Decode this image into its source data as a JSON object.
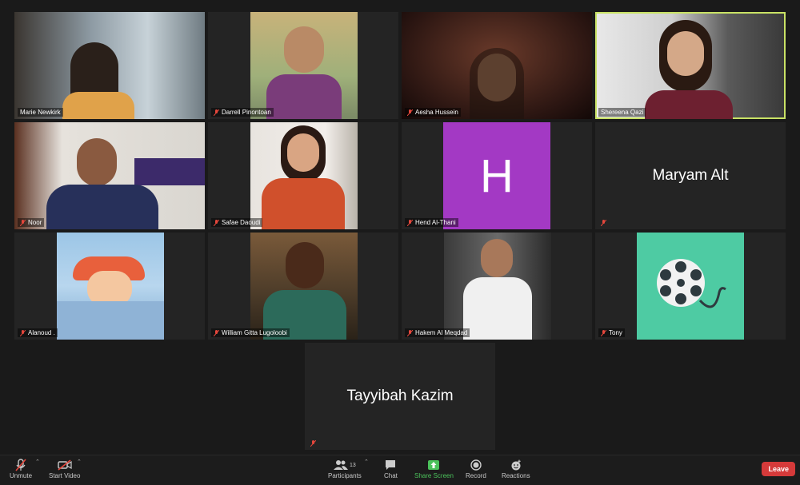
{
  "participants": [
    {
      "name": "Marie Newkirk",
      "muted": false,
      "speaking": false
    },
    {
      "name": "Darrell Pinontoan",
      "muted": true,
      "speaking": false
    },
    {
      "name": "Aesha Hussein",
      "muted": true,
      "speaking": false
    },
    {
      "name": "Shereena Qazi",
      "muted": false,
      "speaking": true
    },
    {
      "name": "Noor",
      "muted": true,
      "speaking": false
    },
    {
      "name": "Safae Daoudi",
      "muted": true,
      "speaking": false
    },
    {
      "name": "Hend Al-Thani",
      "muted": true,
      "speaking": false,
      "avatar_letter": "H",
      "avatar_color": "#a339c4"
    },
    {
      "name": "Maryam Alt",
      "muted": true,
      "speaking": false
    },
    {
      "name": "Alanoud .",
      "muted": true,
      "speaking": false
    },
    {
      "name": "William Gitta Lugoloobi",
      "muted": true,
      "speaking": false
    },
    {
      "name": "Hakem Al Meqdad",
      "muted": true,
      "speaking": false
    },
    {
      "name": "Tony",
      "muted": true,
      "speaking": false,
      "avatar_color": "#4ecba3"
    },
    {
      "name": "Tayyibah Kazim",
      "muted": true,
      "speaking": false
    }
  ],
  "toolbar": {
    "unmute": "Unmute",
    "start_video": "Start Video",
    "participants": "Participants",
    "participants_count": "13",
    "chat": "Chat",
    "share_screen": "Share Screen",
    "record": "Record",
    "reactions": "Reactions",
    "leave": "Leave"
  },
  "colors": {
    "speaking_border": "#c9e265",
    "share_green": "#4bc25b",
    "leave_red": "#d53a3a"
  }
}
